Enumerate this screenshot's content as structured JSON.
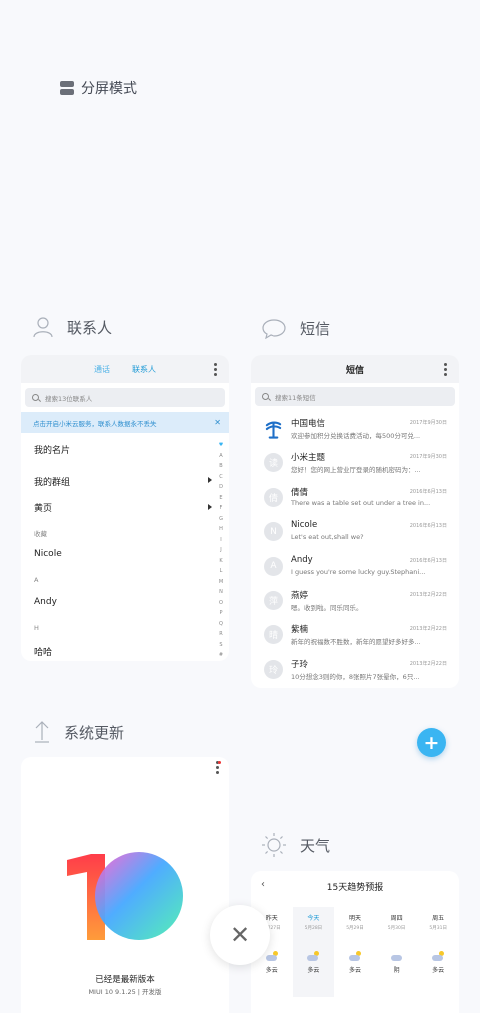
{
  "split_screen": {
    "label": "分屏模式",
    "icon": "split-screen-icon"
  },
  "contacts": {
    "title": "联系人",
    "tabs": [
      "通话",
      "联系人"
    ],
    "search_placeholder": "搜索13位联系人",
    "banner": "点击开启小米云服务，联系人数据永不丢失",
    "banner_close": "✕",
    "rows": [
      {
        "label": "我的名片",
        "type": "item"
      },
      {
        "label": "我的群组",
        "type": "item-arrow"
      },
      {
        "label": "黄页",
        "type": "item-arrow"
      },
      {
        "label": "收藏",
        "type": "section"
      },
      {
        "label": "Nicole",
        "type": "item"
      },
      {
        "label": "A",
        "type": "section"
      },
      {
        "label": "Andy",
        "type": "item"
      },
      {
        "label": "H",
        "type": "section"
      },
      {
        "label": "哈哈",
        "type": "item"
      }
    ],
    "alphabet": [
      "♥",
      "A",
      "B",
      "C",
      "D",
      "E",
      "F",
      "G",
      "H",
      "I",
      "J",
      "K",
      "L",
      "M",
      "N",
      "O",
      "P",
      "Q",
      "R",
      "S",
      "#"
    ]
  },
  "messages": {
    "title": "短信",
    "header_title": "短信",
    "search_placeholder": "搜索11条短信",
    "threads": [
      {
        "avatar": "",
        "name": "中国电信",
        "date": "2017年9月30日",
        "preview": "欢迎参加积分兑换话费活动，每500分可兑..."
      },
      {
        "avatar": "读",
        "name": "小米主题",
        "date": "2017年9月30日",
        "preview": "您好！您的网上营业厅登录的随机密码为：..."
      },
      {
        "avatar": "倩",
        "name": "倩倩",
        "date": "2016年6月13日",
        "preview": "There was a table set out under a tree in..."
      },
      {
        "avatar": "N",
        "name": "Nicole",
        "date": "2016年6月13日",
        "preview": "Let's eat out,shall we?"
      },
      {
        "avatar": "A",
        "name": "Andy",
        "date": "2016年6月13日",
        "preview": "I guess you're some lucky guy.Stephani..."
      },
      {
        "avatar": "萍",
        "name": "燕婷",
        "date": "2013年2月22日",
        "preview": "嗯。收到啦。同乐同乐。"
      },
      {
        "avatar": "晴",
        "name": "紫楠",
        "date": "2013年2月22日",
        "preview": "新年的祝福数不胜数，新年的愿望好多好多..."
      },
      {
        "avatar": "玲",
        "name": "子玲",
        "date": "2013年2月22日",
        "preview": "10分想念3则的你，8张照片7张晕你，6只..."
      }
    ],
    "fab": "+"
  },
  "updater": {
    "title": "系统更新",
    "status": "已经是最新版本",
    "version": "MIUI 10 9.1.25 | 开发版"
  },
  "weather": {
    "title": "天气",
    "header": "15天趋势预报",
    "back": "‹",
    "days": [
      {
        "name": "昨天",
        "date": "5月27日",
        "condition": "多云"
      },
      {
        "name": "今天",
        "date": "5月28日",
        "condition": "多云"
      },
      {
        "name": "明天",
        "date": "5月29日",
        "condition": "多云"
      },
      {
        "name": "周四",
        "date": "5月30日",
        "condition": "阴"
      },
      {
        "name": "周五",
        "date": "5月31日",
        "condition": "多云"
      }
    ]
  },
  "close_button": "✕"
}
